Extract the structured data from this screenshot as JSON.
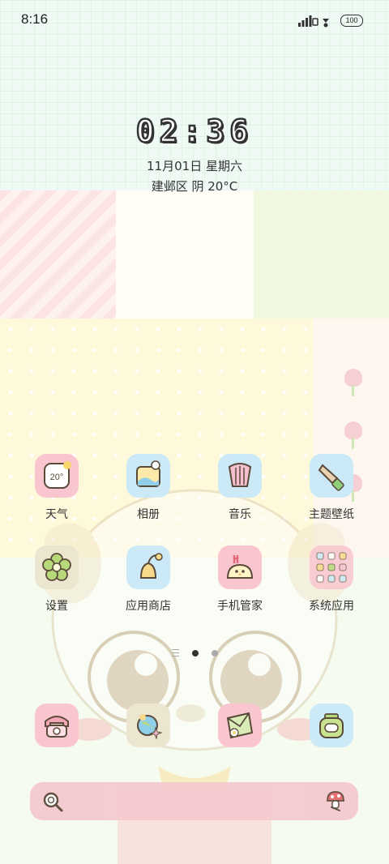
{
  "status_bar": {
    "time": "8:16",
    "battery": "100"
  },
  "clock_widget": {
    "time": "02:36",
    "date": "11月01日 星期六",
    "weather": "建邺区 阴 20°C"
  },
  "apps": [
    {
      "label": "天气",
      "icon": "weather-icon",
      "badge": "20°"
    },
    {
      "label": "相册",
      "icon": "photo-album-icon"
    },
    {
      "label": "音乐",
      "icon": "music-harp-icon"
    },
    {
      "label": "主题壁纸",
      "icon": "paintbrush-icon"
    },
    {
      "label": "设置",
      "icon": "flower-settings-icon"
    },
    {
      "label": "应用商店",
      "icon": "bell-store-icon"
    },
    {
      "label": "手机管家",
      "icon": "chick-security-icon"
    },
    {
      "label": "系统应用",
      "icon": "folder-icon"
    }
  ],
  "page_indicator": {
    "pages": 2,
    "current": 1
  },
  "dock": [
    {
      "icon": "telephone-icon"
    },
    {
      "icon": "browser-globe-icon"
    },
    {
      "icon": "messages-icon"
    },
    {
      "icon": "camera-icon"
    }
  ],
  "search_bar": {
    "icon": "search-icon",
    "assistant_icon": "mushroom-assistant-icon"
  },
  "colors": {
    "icon_pink": "#f9c6cf",
    "icon_blue": "#cbe9f6",
    "search_bg": "#f4c9cf"
  }
}
